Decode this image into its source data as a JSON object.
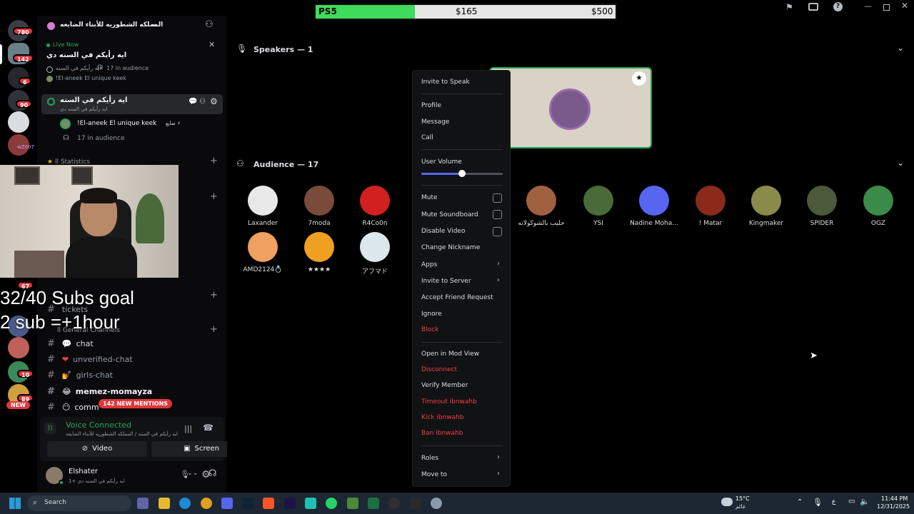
{
  "overlay": {
    "goal_label": "PS5",
    "goal_current": "$165",
    "goal_target": "$500",
    "goal_progress": 0.33,
    "subs_line1": "32/40 Subs goal",
    "subs_line2": "2 sub =+1hour"
  },
  "rail": {
    "badges": [
      "780",
      "142",
      "6",
      "90",
      "67",
      "10",
      "89"
    ],
    "new_label": "NEW",
    "mention_fragment": "wZ007"
  },
  "guild": {
    "name": "المملكه الشطوريه للأبناء الضايعه",
    "live": {
      "label": "Live Now",
      "title": "ايه رأيكم في السنه دي",
      "subline": "ايه رأيكم في السنه",
      "audience": "17 in audience",
      "user": "!El-aneek El unique keek"
    },
    "stage_channel": {
      "name": "ايه رأيكم في السنه",
      "subtitle": "ايه رأيكم في السنه دي",
      "speaker": "!El-aneek El unique keek",
      "speaker_tag": "ضايع ⚡",
      "audience": "17 in audience"
    },
    "categories": {
      "statistics": "ll Statistics",
      "general": "ll General Channels"
    },
    "channels": [
      "tickets",
      "chat",
      "unverified-chat",
      "girls-chat",
      "memez-momayza",
      "comm"
    ],
    "mentions_pill": "142 NEW MENTIONS"
  },
  "voice": {
    "status": "Voice Connected",
    "location": "ايه رأيكم في السنه / المملكه الشطوريه للأبناء الضايعه",
    "video_label": "Video",
    "screen_label": "Screen"
  },
  "user": {
    "name": "Elshater",
    "status": "ايه رأيكم في السنه دي +1"
  },
  "stage": {
    "speakers_title": "Speakers — 1",
    "audience_title": "Audience — 17",
    "audience": [
      {
        "name": "Laxander",
        "color": "#e8e8e8"
      },
      {
        "name": "7moda",
        "color": "#7a4a3a"
      },
      {
        "name": "R4Co0n",
        "color": "#d02020"
      },
      {
        "name": "حليب بالشوكولاته",
        "color": "#a06040"
      },
      {
        "name": "YSI",
        "color": "#4a6a3a"
      },
      {
        "name": "Nadine Moha...",
        "color": "#5865f2"
      },
      {
        "name": "! Matar",
        "color": "#8a2a1a"
      },
      {
        "name": "Kingmaker",
        "color": "#8a8a4a"
      },
      {
        "name": "SPIDER",
        "color": "#4a5a3a"
      },
      {
        "name": "OGZ",
        "color": "#3a8a4a"
      },
      {
        "name": "AMD2124💍",
        "color": "#f0a060"
      },
      {
        "name": "★★★★",
        "color": "#f0a020"
      },
      {
        "name": "アフマド",
        "color": "#dde8ee"
      }
    ]
  },
  "context_menu": {
    "invite_to_speak": "Invite to Speak",
    "profile": "Profile",
    "message": "Message",
    "call": "Call",
    "user_volume": "User Volume",
    "user_volume_level": 0.5,
    "mute": "Mute",
    "mute_soundboard": "Mute Soundboard",
    "disable_video": "Disable Video",
    "change_nickname": "Change Nickname",
    "apps": "Apps",
    "invite_to_server": "Invite to Server",
    "accept_friend_request": "Accept Friend Request",
    "ignore": "Ignore",
    "block": "Block",
    "open_in_mod_view": "Open in Mod View",
    "disconnect": "Disconnect",
    "verify_member": "Verify Member",
    "timeout": "Timeout ibnwahb",
    "kick": "Kick ibnwahb",
    "ban": "Ban ibnwahb",
    "roles": "Roles",
    "move_to": "Move to"
  },
  "taskbar": {
    "search_placeholder": "Search",
    "weather_temp": "15°C",
    "weather_desc": "غائم",
    "lang": "ع",
    "time": "11:44 PM",
    "date": "12/31/2025"
  },
  "colors": {
    "accent": "#5865f2",
    "danger": "#f23f43",
    "online": "#23a55a",
    "progress": "#3ddc5a"
  }
}
